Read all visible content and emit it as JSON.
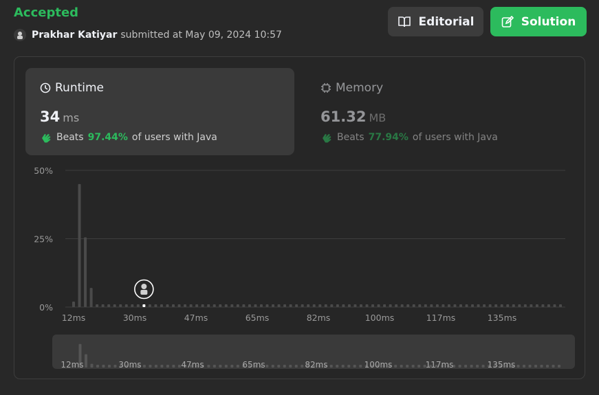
{
  "header": {
    "status": "Accepted",
    "author": "Prakhar Katiyar",
    "submitted_text": "submitted at May 09, 2024 10:57",
    "editorial_label": "Editorial",
    "solution_label": "Solution"
  },
  "runtime": {
    "title": "Runtime",
    "value": "34",
    "unit": "ms",
    "beats_label": "Beats",
    "beats_pct": "97.44%",
    "beats_suffix": "of users with Java"
  },
  "memory": {
    "title": "Memory",
    "value": "61.32",
    "unit": "MB",
    "beats_label": "Beats",
    "beats_pct": "77.94%",
    "beats_suffix": "of users with Java"
  },
  "colors": {
    "accent_green": "#2cbb5d",
    "bar": "#4a4a4a",
    "grid": "#3e3e3e",
    "background": "#282828"
  },
  "chart_data": {
    "type": "bar",
    "xlabel": "",
    "ylabel": "",
    "ylim": [
      0,
      50
    ],
    "y_ticks": [
      "0%",
      "25%",
      "50%"
    ],
    "x_tick_labels": [
      "12ms",
      "30ms",
      "47ms",
      "65ms",
      "82ms",
      "100ms",
      "117ms",
      "135ms"
    ],
    "values": [
      2,
      45,
      25.5,
      7,
      1,
      1,
      1,
      1,
      1,
      1,
      1,
      1,
      1,
      1,
      1,
      1,
      1,
      1,
      1,
      1,
      1,
      1,
      1,
      1,
      1,
      1,
      1,
      1,
      1,
      1,
      1,
      1,
      1,
      1,
      1,
      1,
      1,
      1,
      1,
      1,
      1,
      1,
      1,
      1,
      1,
      1,
      1,
      1,
      1,
      1,
      1,
      1,
      1,
      1,
      1,
      1,
      1,
      1,
      1,
      1,
      1,
      1,
      1,
      1,
      1,
      1,
      1,
      1,
      1,
      1,
      1,
      1,
      1,
      1,
      1,
      1,
      1,
      1,
      1,
      1,
      1,
      1,
      1,
      1
    ],
    "highlight_index": 12,
    "grid": true
  }
}
